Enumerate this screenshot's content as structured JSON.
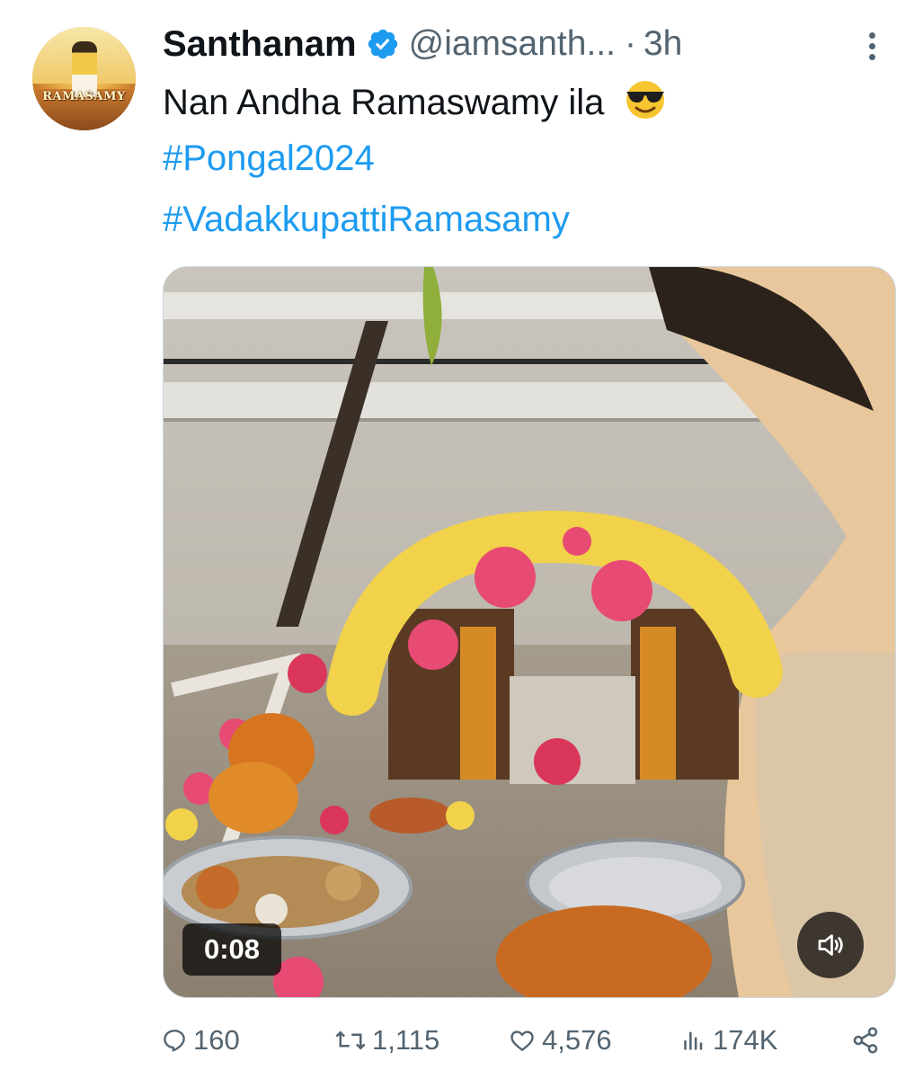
{
  "tweet": {
    "author": {
      "display_name": "Santhanam",
      "handle": "@iamsanth...",
      "separator": "·",
      "timestamp": "3h",
      "avatar_logo_text": "RAMASAMY",
      "verified": true
    },
    "lines": {
      "text": "Nan Andha Ramaswamy ila",
      "emoji": "smiling-face-with-sunglasses",
      "hashtag_1": "#Pongal2024",
      "hashtag_2": "#VadakkupattiRamasamy"
    },
    "video": {
      "duration": "0:08",
      "sound_icon": "volume-icon"
    },
    "actions": {
      "replies": "160",
      "reposts": "1,115",
      "likes": "4,576",
      "views": "174K"
    }
  },
  "colors": {
    "link": "#1d9bf0",
    "secondary_text": "#536471",
    "verified_badge": "#1d9bf0"
  }
}
